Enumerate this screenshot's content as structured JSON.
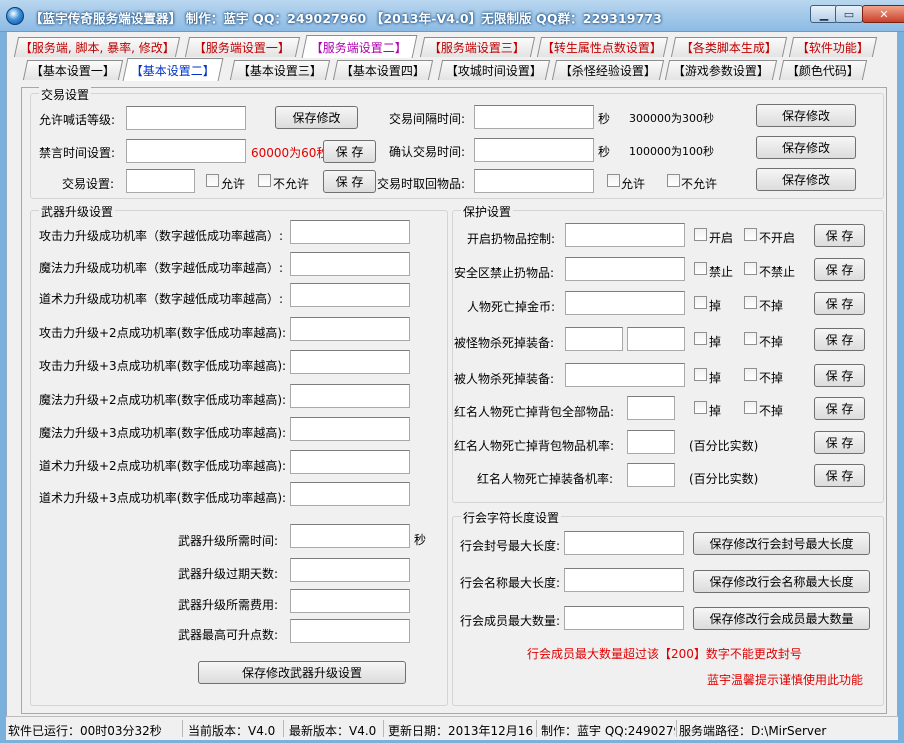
{
  "window": {
    "title": "【蓝宇传奇服务端设置器】 制作：蓝宇 QQ：249027960 【2013年-V4.0】无限制版 QQ群：229319773",
    "min": "▁",
    "max": "▭",
    "close": "✕"
  },
  "tabs_top": [
    "【服务端, 脚本, 暴率, 修改】",
    "【服务端设置一】",
    "【服务端设置二】",
    "【服务端设置三】",
    "【转生属性点数设置】",
    "【各类脚本生成】",
    "【软件功能】"
  ],
  "tabs_sub": [
    "【基本设置一】",
    "【基本设置二】",
    "【基本设置三】",
    "【基本设置四】",
    "【攻城时间设置】",
    "【杀怪经验设置】",
    "【游戏参数设置】",
    "【颜色代码】"
  ],
  "trade": {
    "group": "交易设置",
    "shout_level": "允许喊话等级:",
    "mute_time": "禁言时间设置:",
    "mute_hint": "60000为60秒",
    "trade_setting": "交易设置:",
    "allow": "允许",
    "disallow": "不允许",
    "save_modify": "保存修改",
    "save": "保 存",
    "interval": "交易间隔时间:",
    "sec": "秒",
    "interval_hint": "300000为300秒",
    "confirm": "确认交易时间:",
    "confirm_hint": "100000为100秒",
    "retrieve": "交易时取回物品:"
  },
  "weapon": {
    "group": "武器升级设置",
    "rows": [
      "攻击力升级成功机率（数字越低成功率越高）:",
      "魔法力升级成功机率（数字越低成功率越高）:",
      "道术力升级成功机率（数字越低成功率越高）:",
      "攻击力升级+2点成功机率(数字低成功率越高):",
      "攻击力升级+3点成功机率(数字低成功率越高):",
      "魔法力升级+2点成功机率(数字低成功率越高):",
      "魔法力升级+3点成功机率(数字低成功率越高):",
      "道术力升级+2点成功机率(数字低成功率越高):",
      "道术力升级+3点成功机率(数字低成功率越高):"
    ],
    "time": "武器升级所需时间:",
    "sec": "秒",
    "expire": "武器升级过期天数:",
    "cost": "武器升级所需费用:",
    "max": "武器最高可升点数:",
    "save": "保存修改武器升级设置"
  },
  "protect": {
    "group": "保护设置",
    "save": "保 存",
    "rows": [
      {
        "label": "开启扔物品控制:",
        "a": "开启",
        "b": "不开启"
      },
      {
        "label": "安全区禁止扔物品:",
        "a": "禁止",
        "b": "不禁止"
      },
      {
        "label": "人物死亡掉金币:",
        "a": "掉",
        "b": "不掉"
      },
      {
        "label": "被怪物杀死掉装备:",
        "a": "掉",
        "b": "不掉"
      },
      {
        "label": "被人物杀死掉装备:",
        "a": "掉",
        "b": "不掉"
      },
      {
        "label": "红名人物死亡掉背包全部物品:",
        "a": "掉",
        "b": "不掉"
      },
      {
        "label": "红名人物死亡掉背包物品机率:",
        "note": "(百分比实数)"
      },
      {
        "label": "红名人物死亡掉装备机率:",
        "note": "(百分比实数)"
      }
    ]
  },
  "guild": {
    "group": "行会字符长度设置",
    "seal": "行会封号最大长度:",
    "name": "行会名称最大长度:",
    "member": "行会成员最大数量:",
    "btn_seal": "保存修改行会封号最大长度",
    "btn_name": "保存修改行会名称最大长度",
    "btn_member": "保存修改行会成员最大数量",
    "warn": "行会成员最大数量超过该【200】数字不能更改封号",
    "tip": "蓝宇温馨提示谨慎使用此功能"
  },
  "status": {
    "runtime": "软件已运行：00时03分32秒",
    "current": "当前版本：V4.0",
    "latest": "最新版本：V4.0",
    "update": "更新日期：2013年12月16日",
    "author": "制作：蓝宇 QQ:249027960",
    "path": "服务端路径：D:\\MirServer"
  },
  "colors": {
    "accent_red": "#e00000",
    "tab_selected_top": "#b000b0",
    "tab_selected_sub": "#0033cc"
  }
}
